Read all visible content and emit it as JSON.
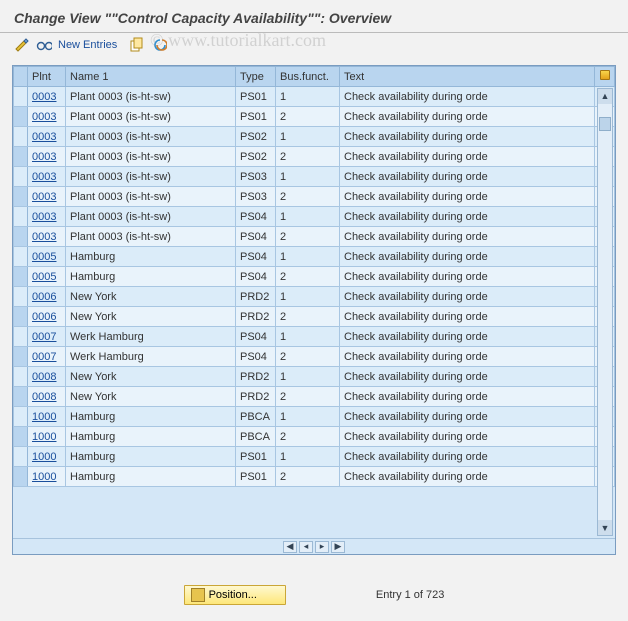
{
  "title": "Change View \"\"Control Capacity Availability\"\": Overview",
  "watermark": "© www.tutorialkart.com",
  "toolbar": {
    "new_entries": "New Entries"
  },
  "columns": {
    "plnt": "Plnt",
    "name": "Name 1",
    "type": "Type",
    "bus": "Bus.funct.",
    "text": "Text"
  },
  "rows": [
    {
      "plnt": "0003",
      "name": "Plant 0003 (is-ht-sw)",
      "type": "PS01",
      "bus": "1",
      "text": "Check availability during orde"
    },
    {
      "plnt": "0003",
      "name": "Plant 0003 (is-ht-sw)",
      "type": "PS01",
      "bus": "2",
      "text": "Check availability during orde"
    },
    {
      "plnt": "0003",
      "name": "Plant 0003 (is-ht-sw)",
      "type": "PS02",
      "bus": "1",
      "text": "Check availability during orde"
    },
    {
      "plnt": "0003",
      "name": "Plant 0003 (is-ht-sw)",
      "type": "PS02",
      "bus": "2",
      "text": "Check availability during orde"
    },
    {
      "plnt": "0003",
      "name": "Plant 0003 (is-ht-sw)",
      "type": "PS03",
      "bus": "1",
      "text": "Check availability during orde"
    },
    {
      "plnt": "0003",
      "name": "Plant 0003 (is-ht-sw)",
      "type": "PS03",
      "bus": "2",
      "text": "Check availability during orde"
    },
    {
      "plnt": "0003",
      "name": "Plant 0003 (is-ht-sw)",
      "type": "PS04",
      "bus": "1",
      "text": "Check availability during orde"
    },
    {
      "plnt": "0003",
      "name": "Plant 0003 (is-ht-sw)",
      "type": "PS04",
      "bus": "2",
      "text": "Check availability during orde"
    },
    {
      "plnt": "0005",
      "name": "Hamburg",
      "type": "PS04",
      "bus": "1",
      "text": "Check availability during orde"
    },
    {
      "plnt": "0005",
      "name": "Hamburg",
      "type": "PS04",
      "bus": "2",
      "text": "Check availability during orde"
    },
    {
      "plnt": "0006",
      "name": "New York",
      "type": "PRD2",
      "bus": "1",
      "text": "Check availability during orde"
    },
    {
      "plnt": "0006",
      "name": "New York",
      "type": "PRD2",
      "bus": "2",
      "text": "Check availability during orde"
    },
    {
      "plnt": "0007",
      "name": "Werk Hamburg",
      "type": "PS04",
      "bus": "1",
      "text": "Check availability during orde"
    },
    {
      "plnt": "0007",
      "name": "Werk Hamburg",
      "type": "PS04",
      "bus": "2",
      "text": "Check availability during orde"
    },
    {
      "plnt": "0008",
      "name": "New York",
      "type": "PRD2",
      "bus": "1",
      "text": "Check availability during orde"
    },
    {
      "plnt": "0008",
      "name": "New York",
      "type": "PRD2",
      "bus": "2",
      "text": "Check availability during orde"
    },
    {
      "plnt": "1000",
      "name": "Hamburg",
      "type": "PBCA",
      "bus": "1",
      "text": "Check availability during orde"
    },
    {
      "plnt": "1000",
      "name": "Hamburg",
      "type": "PBCA",
      "bus": "2",
      "text": "Check availability during orde"
    },
    {
      "plnt": "1000",
      "name": "Hamburg",
      "type": "PS01",
      "bus": "1",
      "text": "Check availability during orde"
    },
    {
      "plnt": "1000",
      "name": "Hamburg",
      "type": "PS01",
      "bus": "2",
      "text": "Check availability during orde"
    }
  ],
  "footer": {
    "position_label": "Position...",
    "entry_status": "Entry 1 of 723"
  }
}
